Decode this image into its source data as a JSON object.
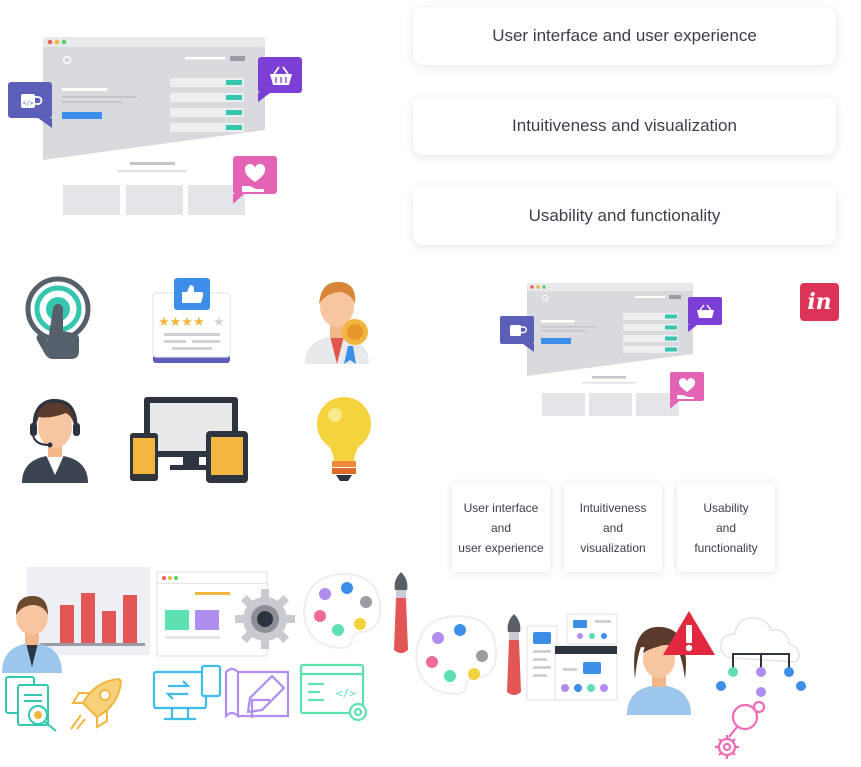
{
  "feature_cards": [
    {
      "label": "User interface and user experience"
    },
    {
      "label": "Intuitiveness and visualization"
    },
    {
      "label": "Usability and functionality"
    }
  ],
  "mini_cards": [
    {
      "line1": "User interface",
      "line2": "and",
      "line3": "user experience"
    },
    {
      "line1": "Intuitiveness",
      "line2": "and",
      "line3": "visualization"
    },
    {
      "line1": "Usability",
      "line2": "and",
      "line3": "functionality"
    }
  ],
  "brand": {
    "logo_text": "in",
    "logo_color": "#dc3458"
  },
  "colors": {
    "purple": "#7b3fd6",
    "pink": "#e364b4",
    "indigo": "#5b5fb8",
    "teal": "#35c6b0",
    "blue": "#3d8ee8",
    "bar_red": "#e25656",
    "mockup_gray": "#d9dadd"
  },
  "icons": [
    "mockup-illustration-icon",
    "coffee-code-icon",
    "basket-icon",
    "heart-hand-icon",
    "touch-icon",
    "rating-icon",
    "award-man-icon",
    "support-agent-icon",
    "devices-icon",
    "lightbulb-icon",
    "invision-logo",
    "bar-chart-man-icon",
    "web-layout-icon",
    "gear-icon",
    "palette-icon",
    "brush-icon",
    "documents-icon",
    "rocket-icon",
    "transfer-icon",
    "design-tools-icon",
    "code-window-icon",
    "flowchart-icon",
    "alert-woman-icon",
    "cloud-network-icon",
    "search-gear-icon"
  ]
}
